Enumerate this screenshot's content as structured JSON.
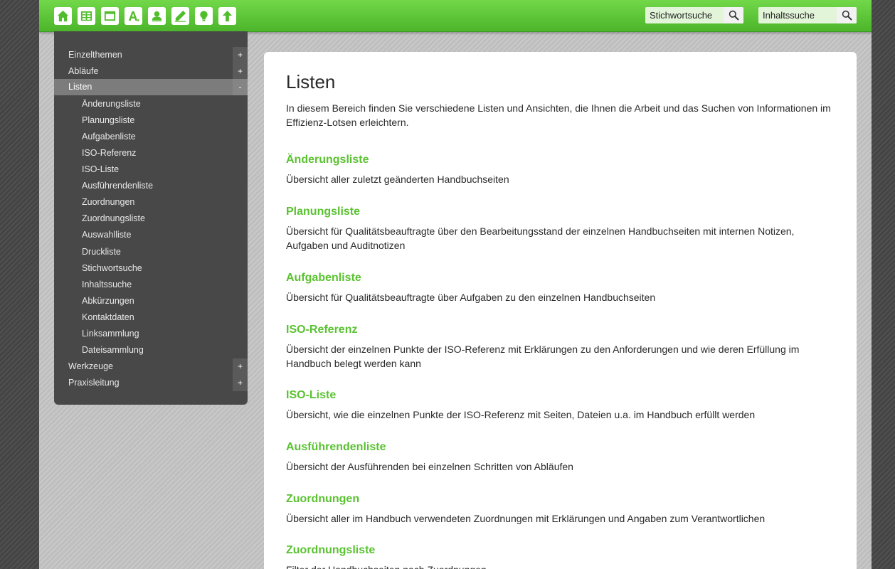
{
  "toolbar": {
    "icons": [
      "home-icon",
      "table-icon",
      "window-icon",
      "font-icon",
      "user-icon",
      "pencil-icon",
      "lightbulb-icon",
      "arrow-up-icon"
    ],
    "keyword_search_value": "Stichwortsuche",
    "content_search_value": "Inhaltssuche"
  },
  "sidebar": {
    "items": [
      {
        "label": "Einzelthemen",
        "toggle": "+"
      },
      {
        "label": "Abläufe",
        "toggle": "+"
      },
      {
        "label": "Listen",
        "toggle": "-"
      }
    ],
    "sub_items": [
      "Änderungsliste",
      "Planungsliste",
      "Aufgabenliste",
      "ISO-Referenz",
      "ISO-Liste",
      "Ausführendenliste",
      "Zuordnungen",
      "Zuordnungsliste",
      "Auswahlliste",
      "Druckliste",
      "Stichwortsuche",
      "Inhaltssuche",
      "Abkürzungen",
      "Kontaktdaten",
      "Linksammlung",
      "Dateisammlung"
    ],
    "bottom_items": [
      {
        "label": "Werkzeuge",
        "toggle": "+"
      },
      {
        "label": "Praxisleitung",
        "toggle": "+"
      }
    ]
  },
  "main": {
    "title": "Listen",
    "intro": "In diesem Bereich finden Sie verschiedene Listen und Ansichten, die Ihnen die Arbeit und das Suchen von Informationen im Effizienz-Lotsen erleichtern.",
    "entries": [
      {
        "title": "Änderungsliste",
        "desc": "Übersicht aller zuletzt geänderten Handbuchseiten"
      },
      {
        "title": "Planungsliste",
        "desc": "Übersicht für Qualitätsbeauftragte über den Bearbeitungsstand der einzelnen Handbuchseiten mit internen Notizen, Aufgaben und Auditnotizen"
      },
      {
        "title": "Aufgabenliste",
        "desc": "Übersicht für Qualitätsbeauftragte über Aufgaben zu den einzelnen Handbuchseiten"
      },
      {
        "title": "ISO-Referenz",
        "desc": "Übersicht der einzelnen Punkte der ISO-Referenz mit Erklärungen zu den Anforderungen und wie deren Erfüllung im Handbuch belegt werden kann"
      },
      {
        "title": "ISO-Liste",
        "desc": "Übersicht, wie die einzelnen Punkte der ISO-Referenz mit Seiten, Dateien u.a. im Handbuch erfüllt werden"
      },
      {
        "title": "Ausführendenliste",
        "desc": "Übersicht der Ausführenden bei einzelnen Schritten von Abläufen"
      },
      {
        "title": "Zuordnungen",
        "desc": "Übersicht aller im Handbuch verwendeten Zuordnungen mit Erklärungen und Angaben zum Verantwortlichen"
      },
      {
        "title": "Zuordnungsliste",
        "desc": "Filter der Handbuchseiten nach Zuordnungen"
      }
    ]
  }
}
